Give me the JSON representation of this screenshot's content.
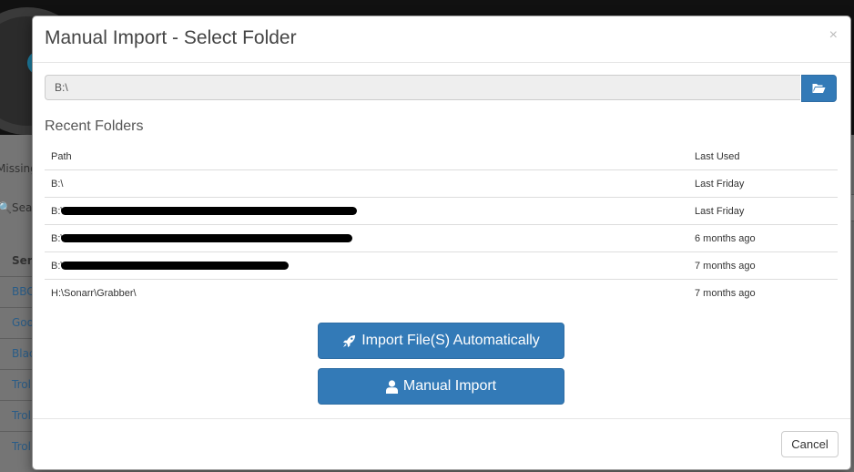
{
  "background": {
    "tab_label": "Missing",
    "search_label": "Search",
    "series_header": "Series",
    "series_items": [
      "BBC",
      "Goo",
      "Blac",
      "Trol",
      "Trol",
      "Trol"
    ]
  },
  "modal": {
    "title": "Manual Import - Select Folder",
    "close_glyph": "×",
    "path_value": "B:\\",
    "recent_title": "Recent Folders",
    "columns": {
      "path": "Path",
      "last_used": "Last Used"
    },
    "rows": [
      {
        "path": "B:\\",
        "last_used": "Last Friday",
        "redacted": false
      },
      {
        "path": "B:\\",
        "last_used": "Last Friday",
        "redacted": true,
        "redact_width": 325
      },
      {
        "path": "B:\\",
        "last_used": "6 months ago",
        "redacted": true,
        "redact_width": 320
      },
      {
        "path": "B:\\",
        "last_used": "7 months ago",
        "redacted": true,
        "redact_width": 250
      },
      {
        "path": "H:\\Sonarr\\Grabber\\",
        "last_used": "7 months ago",
        "redacted": false
      }
    ],
    "import_auto_label": "Import File(S) Automatically",
    "manual_import_label": "Manual Import",
    "cancel_label": "Cancel"
  },
  "icons": {
    "folder_button": "folder-open-icon",
    "import_auto": "rocket-icon",
    "manual_import": "user-icon"
  },
  "colors": {
    "primary": "#337ab7",
    "overlay_bg": "#6b6b6b"
  }
}
